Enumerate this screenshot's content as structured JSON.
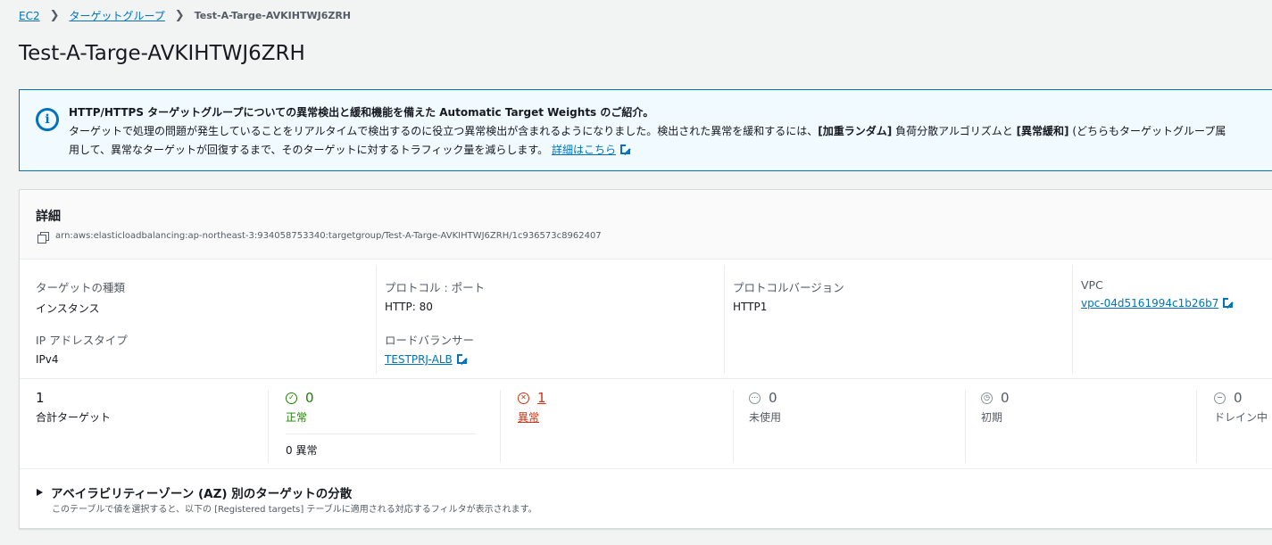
{
  "breadcrumb": {
    "items": [
      "EC2",
      "ターゲットグループ"
    ],
    "current": "Test-A-Targe-AVKIHTWJ6ZRH"
  },
  "page_title": "Test-A-Targe-AVKIHTWJ6ZRH",
  "banner": {
    "title": "HTTP/HTTPS ターゲットグループについての異常検出と緩和機能を備えた Automatic Target Weights のご紹介。",
    "line1_a": "ターゲットで処理の問題が発生していることをリアルタイムで検出するのに役立つ異常検出が含まれるようになりました。検出された異常を緩和するには、",
    "line1_b": "[加重ランダム]",
    "line1_c": " 負荷分散アルゴリズムと ",
    "line1_d": "[異常緩和]",
    "line1_e": " (どちらもターゲットグループ属",
    "line2": "用して、異常なターゲットが回復するまで、そのターゲットに対するトラフィック量を減らします。",
    "link": "詳細はこちら"
  },
  "details": {
    "title": "詳細",
    "arn": "arn:aws:elasticloadbalancing:ap-northeast-3:934058753340:targetgroup/Test-A-Targe-AVKIHTWJ6ZRH/1c936573c8962407",
    "target_type_label": "ターゲットの種類",
    "target_type_value": "インスタンス",
    "ip_type_label": "IP アドレスタイプ",
    "ip_type_value": "IPv4",
    "protocol_port_label": "プロトコル : ポート",
    "protocol_port_value": "HTTP: 80",
    "lb_label": "ロードバランサー",
    "lb_value": "TESTPRJ-ALB",
    "protocol_version_label": "プロトコルバージョン",
    "protocol_version_value": "HTTP1",
    "vpc_label": "VPC",
    "vpc_value": "vpc-04d5161994c1b26b7"
  },
  "stats": {
    "total_value": "1",
    "total_label": "合計ターゲット",
    "healthy_value": "0",
    "healthy_label": "正常",
    "healthy_anomaly": "0 異常",
    "unhealthy_value": "1",
    "unhealthy_label": "異常",
    "unused_value": "0",
    "unused_label": "未使用",
    "initial_value": "0",
    "initial_label": "初期",
    "draining_value": "0",
    "draining_label": "ドレイン中"
  },
  "az": {
    "title": "アベイラビリティーゾーン (AZ) 別のターゲットの分散",
    "description": "このテーブルで値を選択すると、以下の [Registered targets] テーブルに適用される対応するフィルタが表示されます。"
  },
  "colors": {
    "link": "#0073bb",
    "healthy": "#1d8102",
    "unhealthy": "#d13212",
    "banner_bg": "#f1faff"
  }
}
